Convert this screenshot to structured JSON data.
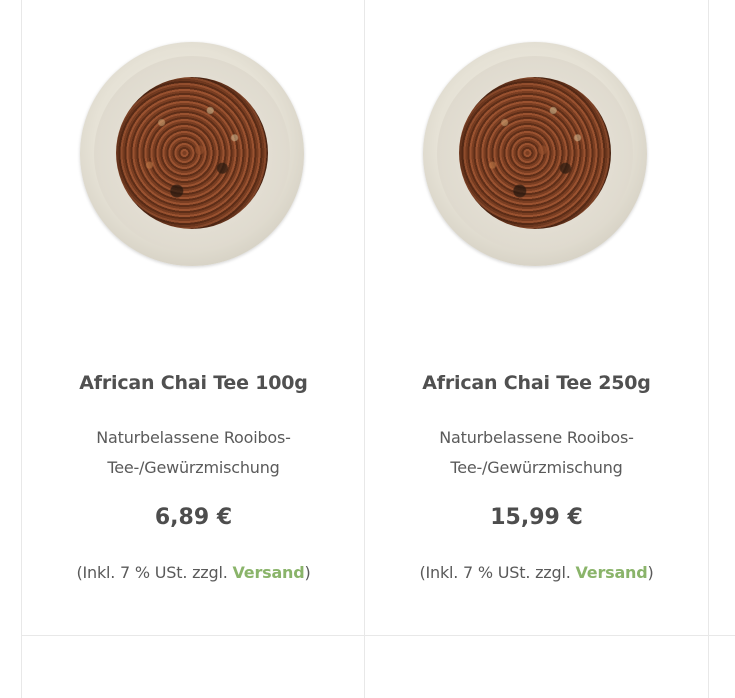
{
  "products": [
    {
      "title": "African Chai Tee 100g",
      "description": "Naturbelassene Rooibos-Tee-/Gewürzmischung",
      "price": "6,89 €",
      "tax_prefix": "(Inkl. 7 % USt. zzgl. ",
      "shipping_link": "Versand",
      "tax_suffix": ")",
      "image_icon": "tea-jar-image"
    },
    {
      "title": "African Chai Tee 250g",
      "description": "Naturbelassene Rooibos-Tee-/Gewürzmischung",
      "price": "15,99 €",
      "tax_prefix": "(Inkl. 7 % USt. zzgl. ",
      "shipping_link": "Versand",
      "tax_suffix": ")",
      "image_icon": "tea-jar-image"
    }
  ],
  "colors": {
    "link": "#8ab46a",
    "text": "#4d4d4d",
    "divider": "#e8e8e8"
  }
}
